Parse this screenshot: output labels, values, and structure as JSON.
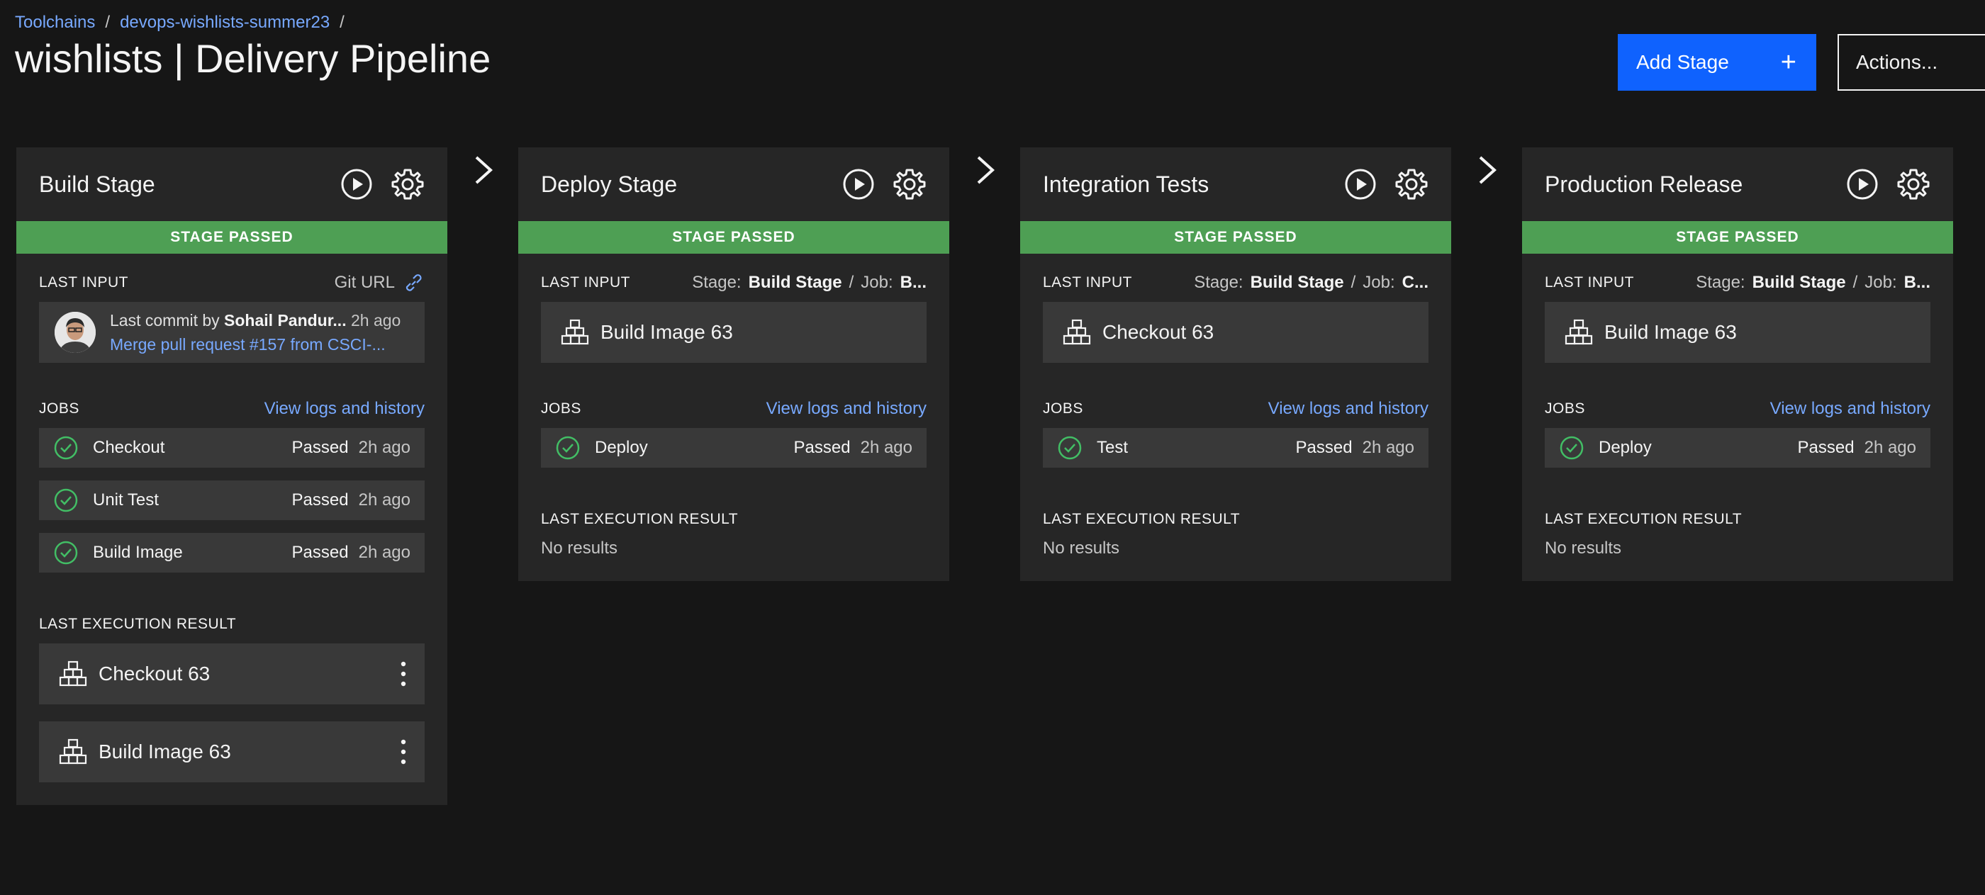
{
  "breadcrumb": {
    "item1": "Toolchains",
    "sep1": "/",
    "item2": "devops-wishlists-summer23",
    "sep2": "/"
  },
  "page": {
    "title": "wishlists | Delivery Pipeline"
  },
  "header": {
    "add_stage_label": "Add Stage",
    "add_stage_icon": "+",
    "actions_label": "Actions..."
  },
  "colors": {
    "status_passed": "#4e9f54",
    "link": "#78a9ff",
    "primary_button": "#0f62fe",
    "background": "#161616",
    "card": "#262626",
    "tile": "#393939"
  },
  "labels": {
    "status": "STAGE PASSED",
    "last_input": "LAST INPUT",
    "jobs": "JOBS",
    "view_logs": "View logs and history",
    "last_execution_result": "LAST EXECUTION RESULT",
    "no_results": "No results"
  },
  "stages": [
    {
      "name": "Build Stage",
      "input_source": "Git URL",
      "commit": {
        "prefix": "Last commit by",
        "author": "Sohail Pandur...",
        "time": "2h ago",
        "message": "Merge pull request #157 from CSCI-..."
      },
      "jobs": [
        {
          "name": "Checkout",
          "status": "Passed",
          "time": "2h ago"
        },
        {
          "name": "Unit Test",
          "status": "Passed",
          "time": "2h ago"
        },
        {
          "name": "Build Image",
          "status": "Passed",
          "time": "2h ago"
        }
      ],
      "results": [
        {
          "label": "Checkout 63"
        },
        {
          "label": "Build Image 63"
        }
      ]
    },
    {
      "name": "Deploy Stage",
      "input": {
        "stage_prefix": "Stage:",
        "stage": "Build Stage",
        "sep": "/",
        "job_prefix": "Job:",
        "job": "B..."
      },
      "input_tile": "Build Image 63",
      "jobs": [
        {
          "name": "Deploy",
          "status": "Passed",
          "time": "2h ago"
        }
      ]
    },
    {
      "name": "Integration Tests",
      "input": {
        "stage_prefix": "Stage:",
        "stage": "Build Stage",
        "sep": "/",
        "job_prefix": "Job:",
        "job": "C..."
      },
      "input_tile": "Checkout 63",
      "jobs": [
        {
          "name": "Test",
          "status": "Passed",
          "time": "2h ago"
        }
      ]
    },
    {
      "name": "Production Release",
      "input": {
        "stage_prefix": "Stage:",
        "stage": "Build Stage",
        "sep": "/",
        "job_prefix": "Job:",
        "job": "B..."
      },
      "input_tile": "Build Image 63",
      "jobs": [
        {
          "name": "Deploy",
          "status": "Passed",
          "time": "2h ago"
        }
      ]
    }
  ],
  "icons": {
    "run": "play-circle-icon",
    "settings": "gear-icon",
    "link": "link-icon",
    "check": "checkmark-circle-icon",
    "artifact": "stacked-boxes-icon",
    "overflow": "overflow-menu-icon",
    "flow_arrow": "chevron-right-icon",
    "avatar": "user-avatar"
  }
}
